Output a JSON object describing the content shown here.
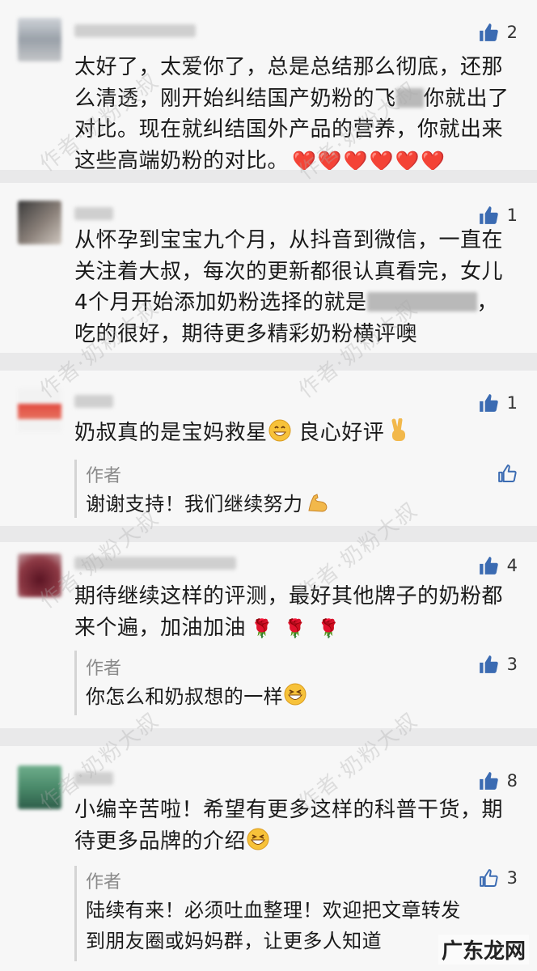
{
  "comments": [
    {
      "likes": "2",
      "text_a": "太好了，太爱你了，总是总结那么彻底，还那\n么清透，刚开始纠结国产奶粉的飞",
      "text_b": "你就出了\n对比。现在就纠结国外产品的营养，你就出来\n这些高端奶粉的对比。",
      "emoji": "❤️❤️❤️❤️❤️❤️"
    },
    {
      "likes": "1",
      "text_a": "从怀孕到宝宝九个月，从抖音到微信，一直在\n关注着大叔，每次的更新都很认真看完，女儿\n4个月开始添加奶粉选择的就是",
      "text_b": "，\n吃的很好，期待更多精彩奶粉横评噢"
    },
    {
      "likes": "1",
      "text": "奶叔真的是宝妈救星",
      "text2": " 良心好评",
      "reply": {
        "author": "作者",
        "likes": "",
        "text": "谢谢支持！我们继续努力"
      }
    },
    {
      "likes": "4",
      "text": "期待继续这样的评测，最好其他牌子的奶粉都\n来个遍，加油加油",
      "reply": {
        "author": "作者",
        "likes": "3",
        "text": "你怎么和奶叔想的一样"
      }
    },
    {
      "likes": "8",
      "text": "小编辛苦啦！希望有更多这样的科普干货，期\n待更多品牌的介绍",
      "reply": {
        "author": "作者",
        "likes": "3",
        "text": "陆续有来！必须吐血整理！欢迎把文章转发\n到朋友圈或妈妈群，让更多人知道"
      }
    }
  ],
  "watermark": "作者·奶粉大叔",
  "corner_logo": "广东龙网",
  "colors": {
    "like_blue": "#3b6bb2",
    "background": "#f7f7f7",
    "divider": "#e6e6e6"
  }
}
